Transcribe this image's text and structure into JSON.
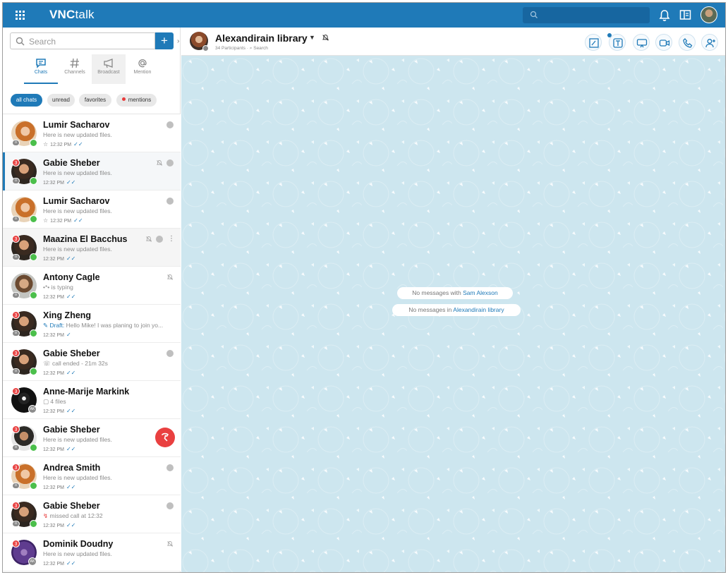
{
  "app": {
    "brand_bold": "VNC",
    "brand_rest": "talk"
  },
  "sidebar": {
    "search_placeholder": "Search",
    "add_label": "+",
    "tabs": [
      {
        "label": "Chats",
        "active": true
      },
      {
        "label": "Channels",
        "active": false
      },
      {
        "label": "Broadcast",
        "active": false
      },
      {
        "label": "Mention",
        "active": false
      }
    ],
    "filters": [
      {
        "label": "all chats",
        "active": true
      },
      {
        "label": "unread",
        "active": false
      },
      {
        "label": "favorites",
        "active": false
      },
      {
        "label": "mentions",
        "active": false
      }
    ],
    "conversations": [
      {
        "name": "Lumir Sacharov",
        "preview": "Here is new updated files.",
        "time": "12:32 PM",
        "badge": "",
        "starred": true
      },
      {
        "name": "Gabie Sheber",
        "preview": "Here is new updated files.",
        "time": "12:32 PM",
        "badge": "3",
        "starred": false
      },
      {
        "name": "Lumir Sacharov",
        "preview": "Here is new updated files.",
        "time": "12:32 PM",
        "badge": "",
        "starred": true
      },
      {
        "name": "Maazina El Bacchus",
        "preview": "Here is new updated files.",
        "time": "12:32 PM",
        "badge": "3",
        "starred": false
      },
      {
        "name": "Antony Cagle",
        "preview": "is typing",
        "time": "12:32 PM",
        "badge": "",
        "starred": false
      },
      {
        "name": "Xing Zheng",
        "draft_label": "Draft:",
        "preview": "Hello Mike! I was planing to join yo...",
        "time": "12:32 PM",
        "badge": "3",
        "starred": false
      },
      {
        "name": "Gabie Sheber",
        "preview": "call ended - 21m 32s",
        "time": "12:32 PM",
        "badge": "3",
        "starred": false
      },
      {
        "name": "Anne-Marije Markink",
        "preview": "4 files",
        "time": "12:32 PM",
        "badge": "3",
        "starred": false,
        "tag": "AK"
      },
      {
        "name": "Gabie Sheber",
        "preview": "Here is new updated files.",
        "time": "12:32 PM",
        "badge": "3",
        "starred": false
      },
      {
        "name": "Andrea Smith",
        "preview": "Here is new updated files.",
        "time": "12:32 PM",
        "badge": "3",
        "starred": false
      },
      {
        "name": "Gabie Sheber",
        "preview": "missed call at 12:32",
        "time": "12:32 PM",
        "badge": "3",
        "starred": false
      },
      {
        "name": "Dominik Doudny",
        "preview": "Here is new updated files.",
        "time": "12:32 PM",
        "badge": "3",
        "starred": false,
        "tag": "AK"
      }
    ]
  },
  "room": {
    "title": "Alexandirain library",
    "participants": "34 Participants",
    "search_label": "Search",
    "header_actions": [
      "whiteboard-icon",
      "text-tool-icon",
      "screen-share-icon",
      "video-call-icon",
      "phone-call-icon",
      "add-participant-icon"
    ]
  },
  "empty_state": {
    "with_prefix": "No messages with",
    "with_name": "Sam Alexson",
    "in_prefix": "No messages in",
    "in_name": "Alexandirain library"
  },
  "colors": {
    "primary": "#1f7ab8",
    "chat_background": "#cde6ef",
    "badge": "#e84141",
    "online": "#4bbf4b"
  }
}
